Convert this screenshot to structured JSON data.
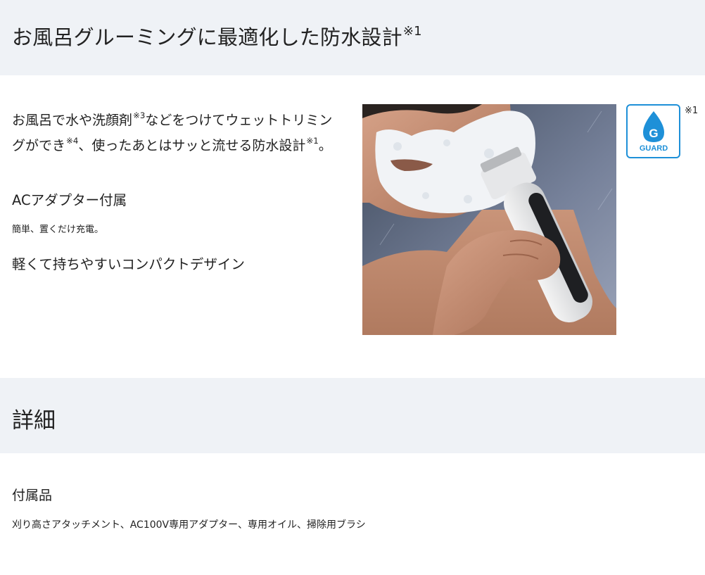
{
  "section1": {
    "heading": "お風呂グルーミングに最適化した防水設計",
    "heading_note": "※1",
    "description": {
      "part1": "お風呂で水や洗顔剤",
      "note1": "※3",
      "part2": "などをつけてウェットトリミングができ",
      "note2": "※4",
      "part3": "、使ったあとはサッと流せる防水設計",
      "note3": "※1",
      "part4": "。"
    },
    "feature1_title": "ACアダプター付属",
    "feature1_sub": "簡単、置くだけ充電。",
    "feature2_title": "軽くて持ちやすいコンパクトデザイン",
    "photo_icon": "man-trimming-beard-photo",
    "badge": {
      "letter": "G",
      "label": "GUARD",
      "note": "※1",
      "color": "#1e90d8"
    }
  },
  "section2": {
    "heading": "詳細",
    "item_title": "付属品",
    "item_text": "刈り高さアタッチメント、AC100V専用アダプター、専用オイル、掃除用ブラシ"
  },
  "colors": {
    "band_bg": "#eff2f6",
    "text": "#222222",
    "accent": "#1e90d8"
  }
}
